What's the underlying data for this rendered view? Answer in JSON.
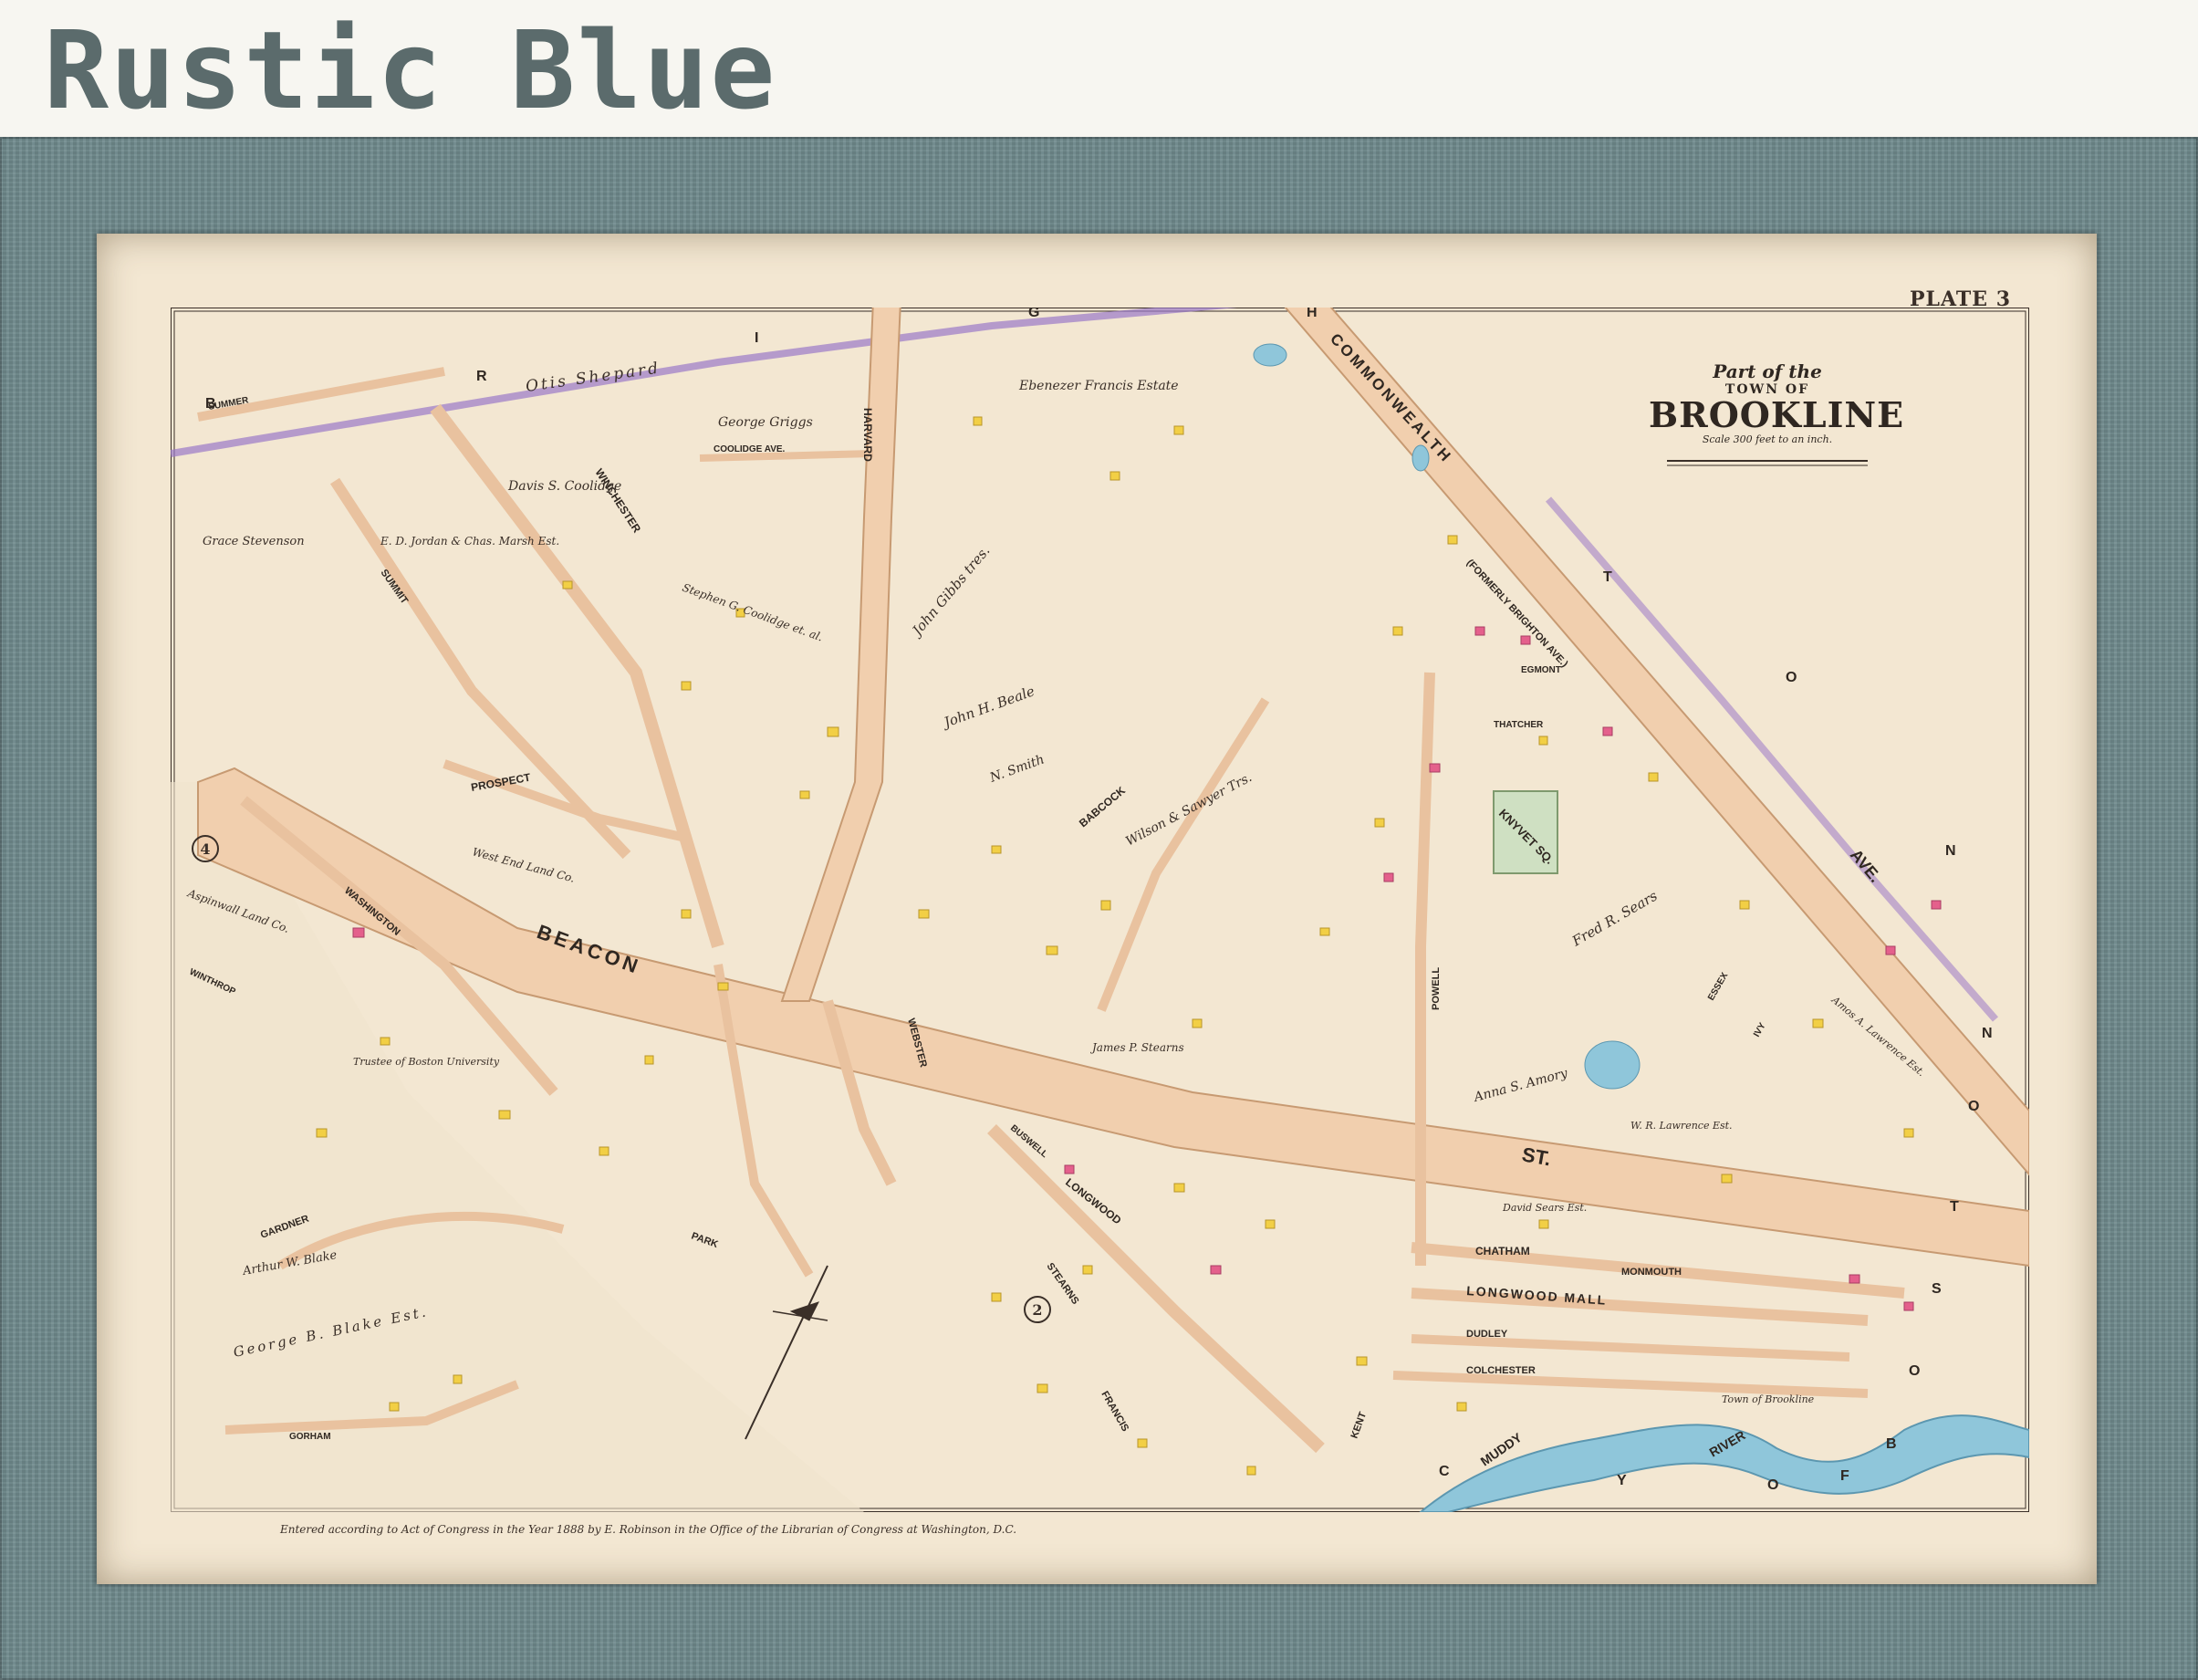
{
  "header": {
    "title": "Rustic Blue"
  },
  "map": {
    "plate": "PLATE 3",
    "title_line1": "Part of the",
    "title_line2": "TOWN OF",
    "title_line3": "BROOKLINE",
    "scale_text": "Scale 300 feet to an inch.",
    "copyright": "Entered according to Act of Congress in the Year 1888 by E. Robinson in the Office of the Librarian of Congress at Washington, D.C.",
    "section_numbers": [
      "4",
      "2"
    ],
    "grid_letters": [
      "B",
      "R",
      "I",
      "G",
      "H",
      "T",
      "O",
      "N",
      "C",
      "Y",
      "O",
      "F",
      "B",
      "O",
      "S",
      "T",
      "O",
      "N"
    ],
    "streets": {
      "beacon": "BEACON",
      "beacon_st": "ST.",
      "commonwealth": "COMMONWEALTH",
      "commonwealth_ave": "AVE.",
      "formerly": "(FORMERLY BRIGHTON AVE.)",
      "harvard": "HARVARD",
      "winchester": "WINCHESTER",
      "summit": "SUMMIT",
      "washington": "WASHINGTON",
      "webster": "WEBSTER",
      "longwood": "LONGWOOD",
      "longwood_mall": "LONGWOOD MALL",
      "chatham": "CHATHAM",
      "dudley": "DUDLEY",
      "colchester": "COLCHESTER",
      "monmouth": "MONMOUTH",
      "gardner": "GARDNER",
      "park": "PARK",
      "prospect": "PROSPECT",
      "babcock": "BABCOCK",
      "powell": "POWELL",
      "francis": "FRANCIS",
      "stearns": "STEARNS",
      "kent": "KENT",
      "coolidge_ave": "COOLIDGE AVE.",
      "summer_st": "SUMMER",
      "winthrop": "WINTHROP",
      "gorham_ave": "GORHAM",
      "knyvet_sq": "KNYVET SQ.",
      "muddy_river": "MUDDY",
      "river": "RIVER",
      "thatcher": "THATCHER",
      "egmont": "EGMONT",
      "essex": "ESSEX",
      "ivy": "IVY",
      "buswell": "BUSWELL"
    },
    "estates": [
      "Otis Shepard",
      "George Griggs",
      "Davis S. Coolidge",
      "Ebenezer Francis Estate",
      "Grace Stevenson",
      "E. D. Jordan & Chas. Marsh Est.",
      "John Gibbs tres.",
      "John H. Beale",
      "N. Smith",
      "Stephen G. Coolidge et. al.",
      "Wilson & Sawyer Trs.",
      "Fred R. Sears",
      "Anna S. Amory",
      "George B. Blake Est.",
      "Arthur W. Blake",
      "Trustee of Boston University",
      "Aspinwall Land Co.",
      "West End Land Co.",
      "James P. Stearns",
      "David Sears Est.",
      "W. R. Lawrence Est.",
      "Amos A. Lawrence Est.",
      "Town of Brookline"
    ]
  }
}
